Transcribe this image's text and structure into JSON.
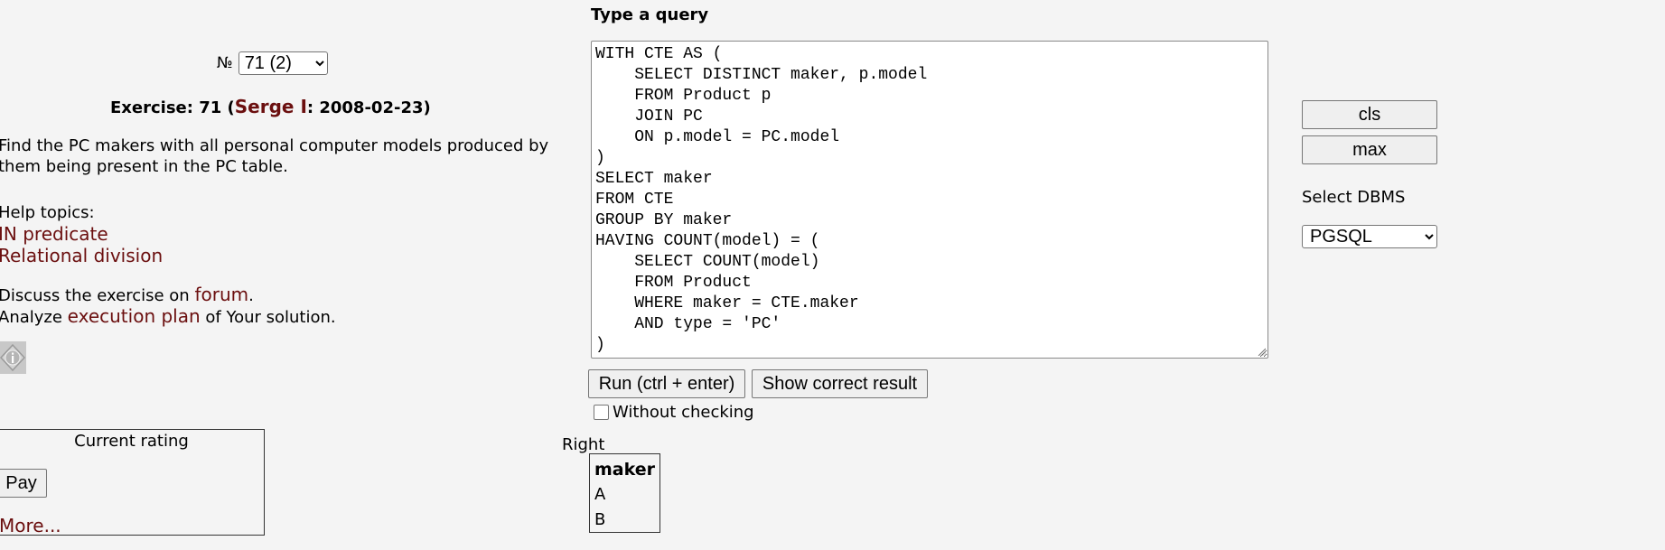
{
  "exercise": {
    "number_symbol": "№",
    "selected": "71 (2)",
    "title_prefix": "Exercise: 71 (",
    "author": "Serge I",
    "title_suffix": ": 2008-02-23)",
    "text": "Find the PC makers with all personal computer models produced by them being present in the PC table."
  },
  "help": {
    "heading": "Help topics:",
    "topics": [
      "IN predicate",
      "Relational division"
    ]
  },
  "discuss": {
    "before": "Discuss the exercise on ",
    "link": "forum",
    "after": "."
  },
  "analyze": {
    "before": "Analyze ",
    "link": "execution plan",
    "after": " of Your solution."
  },
  "rating": {
    "title": "Current rating",
    "pay_label": "Pay",
    "more_label": "More..."
  },
  "query": {
    "label": "Type a query",
    "code": "WITH CTE AS (\n    SELECT DISTINCT maker, p.model\n    FROM Product p\n    JOIN PC\n    ON p.model = PC.model\n)\nSELECT maker\nFROM CTE\nGROUP BY maker\nHAVING COUNT(model) = (\n    SELECT COUNT(model)\n    FROM Product\n    WHERE maker = CTE.maker\n    AND type = 'PC'\n)",
    "run_label": "Run (ctrl + enter)",
    "correct_label": "Show correct result",
    "without_checking_label": "Without checking",
    "without_checking": false
  },
  "side": {
    "cls_label": "cls",
    "max_label": "max",
    "dbms_label": "Select DBMS",
    "dbms_selected": "PGSQL"
  },
  "result": {
    "label": "Right",
    "column": "maker",
    "rows": [
      "A",
      "B"
    ]
  },
  "colors": {
    "link": "#6b0f0f",
    "background": "#f4f4f4"
  }
}
